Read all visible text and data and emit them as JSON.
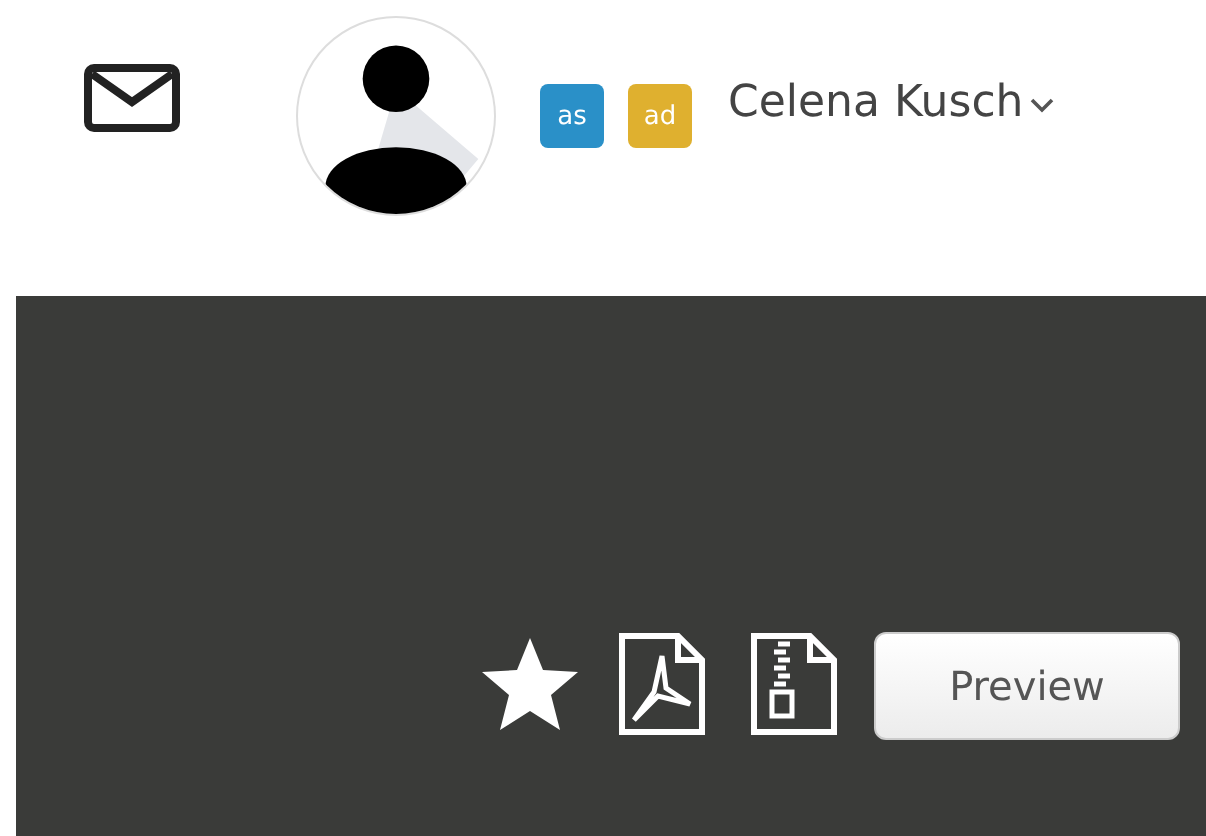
{
  "header": {
    "badges": [
      {
        "label": "as",
        "color": "#2a90c8"
      },
      {
        "label": "ad",
        "color": "#dfb02f"
      }
    ],
    "user_name": "Celena Kusch"
  },
  "panel": {
    "preview_button": "Preview"
  }
}
